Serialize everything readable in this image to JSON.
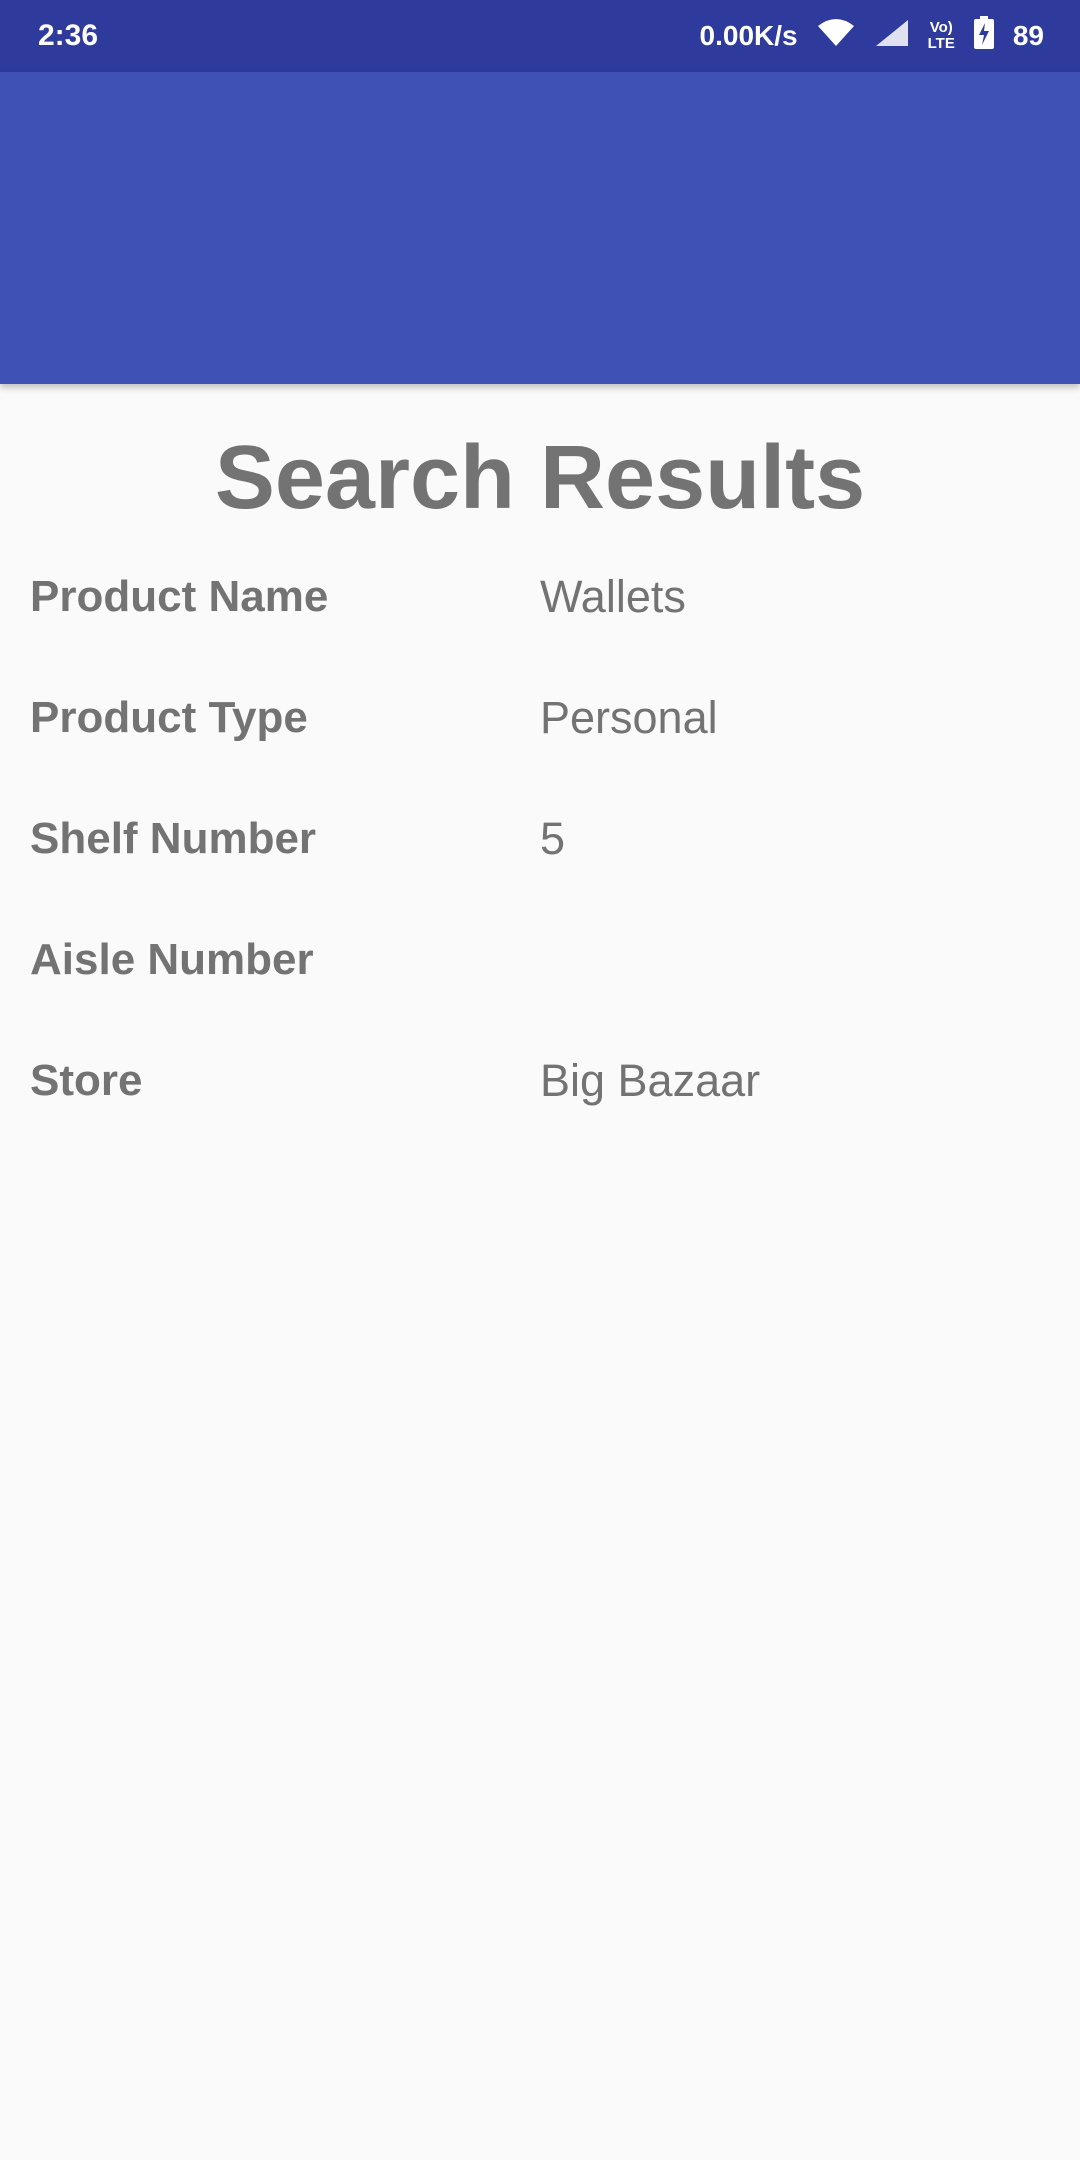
{
  "status_bar": {
    "time": "2:36",
    "network_speed": "0.00K/s",
    "lte_top": "Vo)",
    "lte_bottom": "LTE",
    "battery": "89",
    "icons": [
      "wifi-icon",
      "signal-icon",
      "volte-icon",
      "battery-charging-icon"
    ]
  },
  "app_bar": {
    "color": "#3f51b5"
  },
  "page": {
    "title": "Search Results"
  },
  "details": [
    {
      "label": "Product Name",
      "value": "Wallets"
    },
    {
      "label": "Product Type",
      "value": "Personal"
    },
    {
      "label": "Shelf Number",
      "value": "5"
    },
    {
      "label": "Aisle Number",
      "value": ""
    },
    {
      "label": "Store",
      "value": "Big Bazaar"
    }
  ]
}
